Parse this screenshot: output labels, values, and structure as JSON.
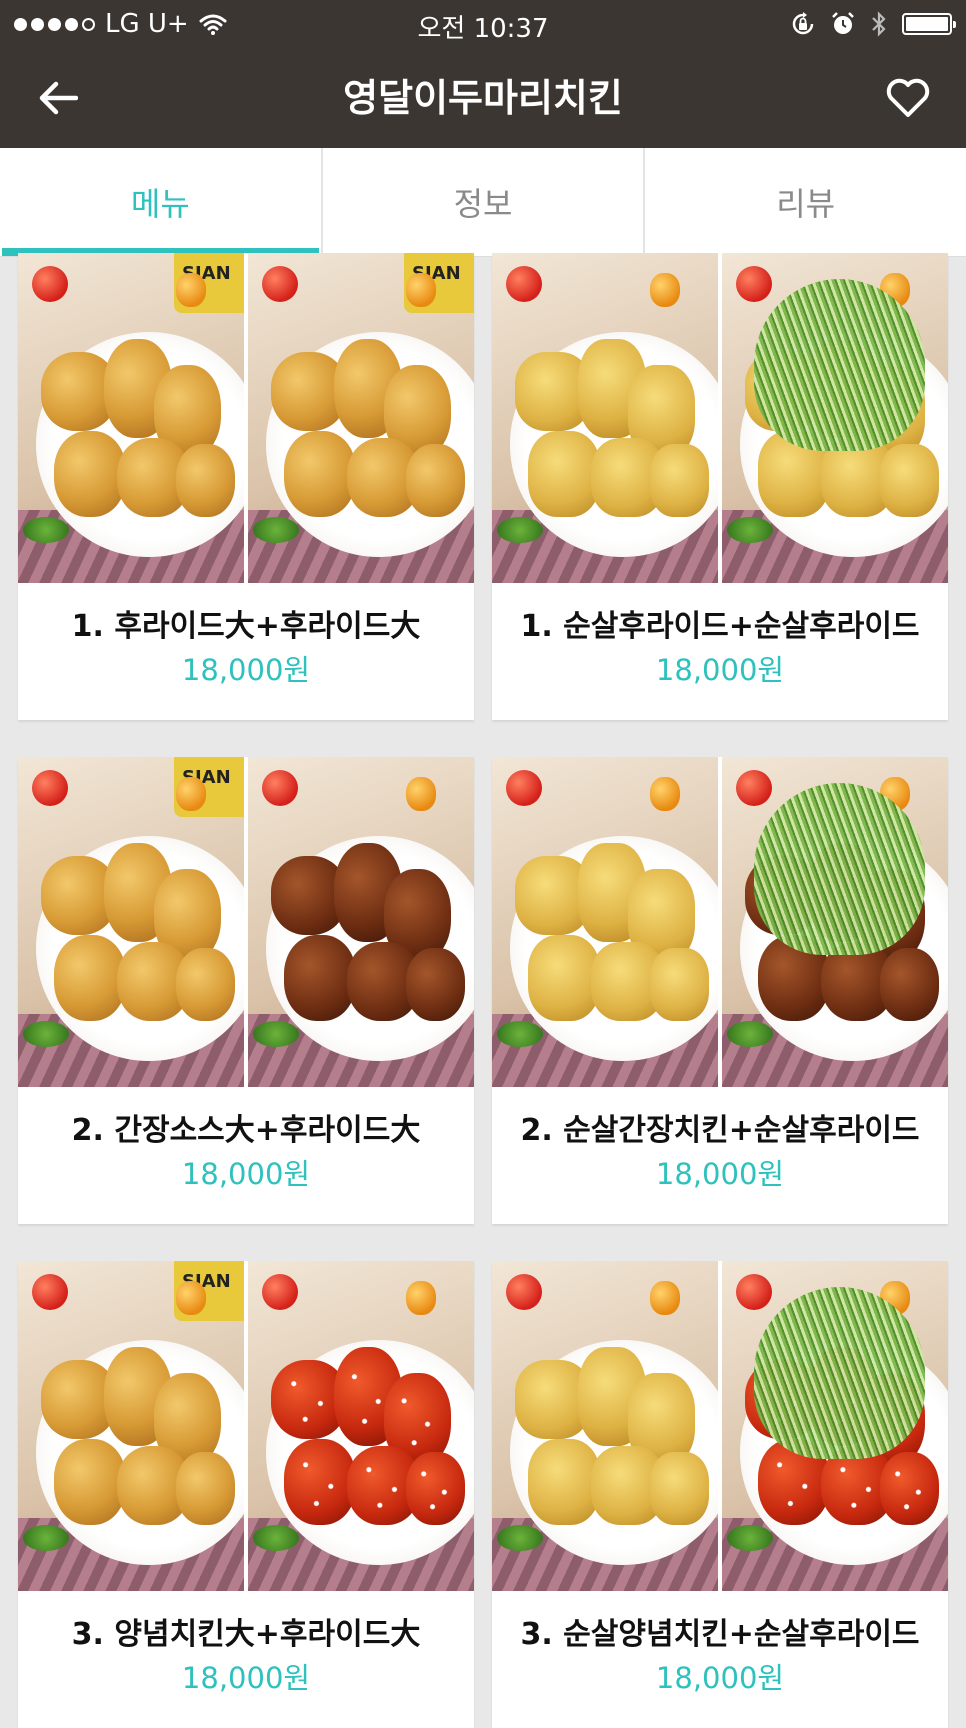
{
  "status": {
    "carrier": "LG U+",
    "time": "오전 10:37",
    "signal_filled": 4,
    "signal_total": 5
  },
  "header": {
    "title": "영달이두마리치킨",
    "back_icon": "arrow-left-icon",
    "favorite_icon": "heart-icon"
  },
  "tabs": [
    {
      "label": "메뉴",
      "active": true
    },
    {
      "label": "정보",
      "active": false
    },
    {
      "label": "리뷰",
      "active": false
    }
  ],
  "menu": [
    {
      "name": "1. 후라이드大+후라이드大",
      "price": "18,000원",
      "left": "fried",
      "right": "fried"
    },
    {
      "name": "1. 순살후라이드+순살후라이드",
      "price": "18,000원",
      "left": "boneless",
      "right": "boneless-greens"
    },
    {
      "name": "2. 간장소스大+후라이드大",
      "price": "18,000원",
      "left": "fried",
      "right": "soy"
    },
    {
      "name": "2. 순살간장치킨+순살후라이드",
      "price": "18,000원",
      "left": "boneless",
      "right": "soy-greens"
    },
    {
      "name": "3. 양념치킨大+후라이드大",
      "price": "18,000원",
      "left": "fried",
      "right": "spicy"
    },
    {
      "name": "3. 순살양념치킨+순살후라이드",
      "price": "18,000원",
      "left": "boneless",
      "right": "spicy-greens"
    }
  ],
  "colors": {
    "accent": "#2ec1bd",
    "header_bg": "#3b3631",
    "page_bg": "#e8e8e8"
  }
}
